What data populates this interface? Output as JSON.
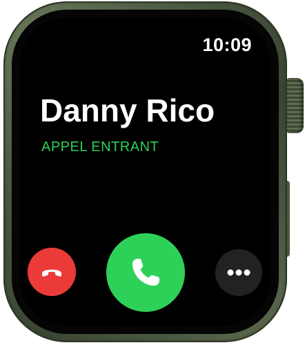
{
  "status_bar": {
    "time": "10:09"
  },
  "call": {
    "caller_name": "Danny Rico",
    "status_label": "APPEL ENTRANT"
  },
  "actions": [
    {
      "name": "decline",
      "icon": "phone-hangup-icon",
      "color": "#eb3b38"
    },
    {
      "name": "accept",
      "icon": "phone-icon",
      "color": "#2ed158"
    },
    {
      "name": "more",
      "icon": "ellipsis-icon",
      "color": "#222222"
    }
  ],
  "colors": {
    "accent_green": "#2ed158",
    "decline_red": "#eb3b38",
    "screen_background": "#000000",
    "case_color": "#46533d"
  }
}
